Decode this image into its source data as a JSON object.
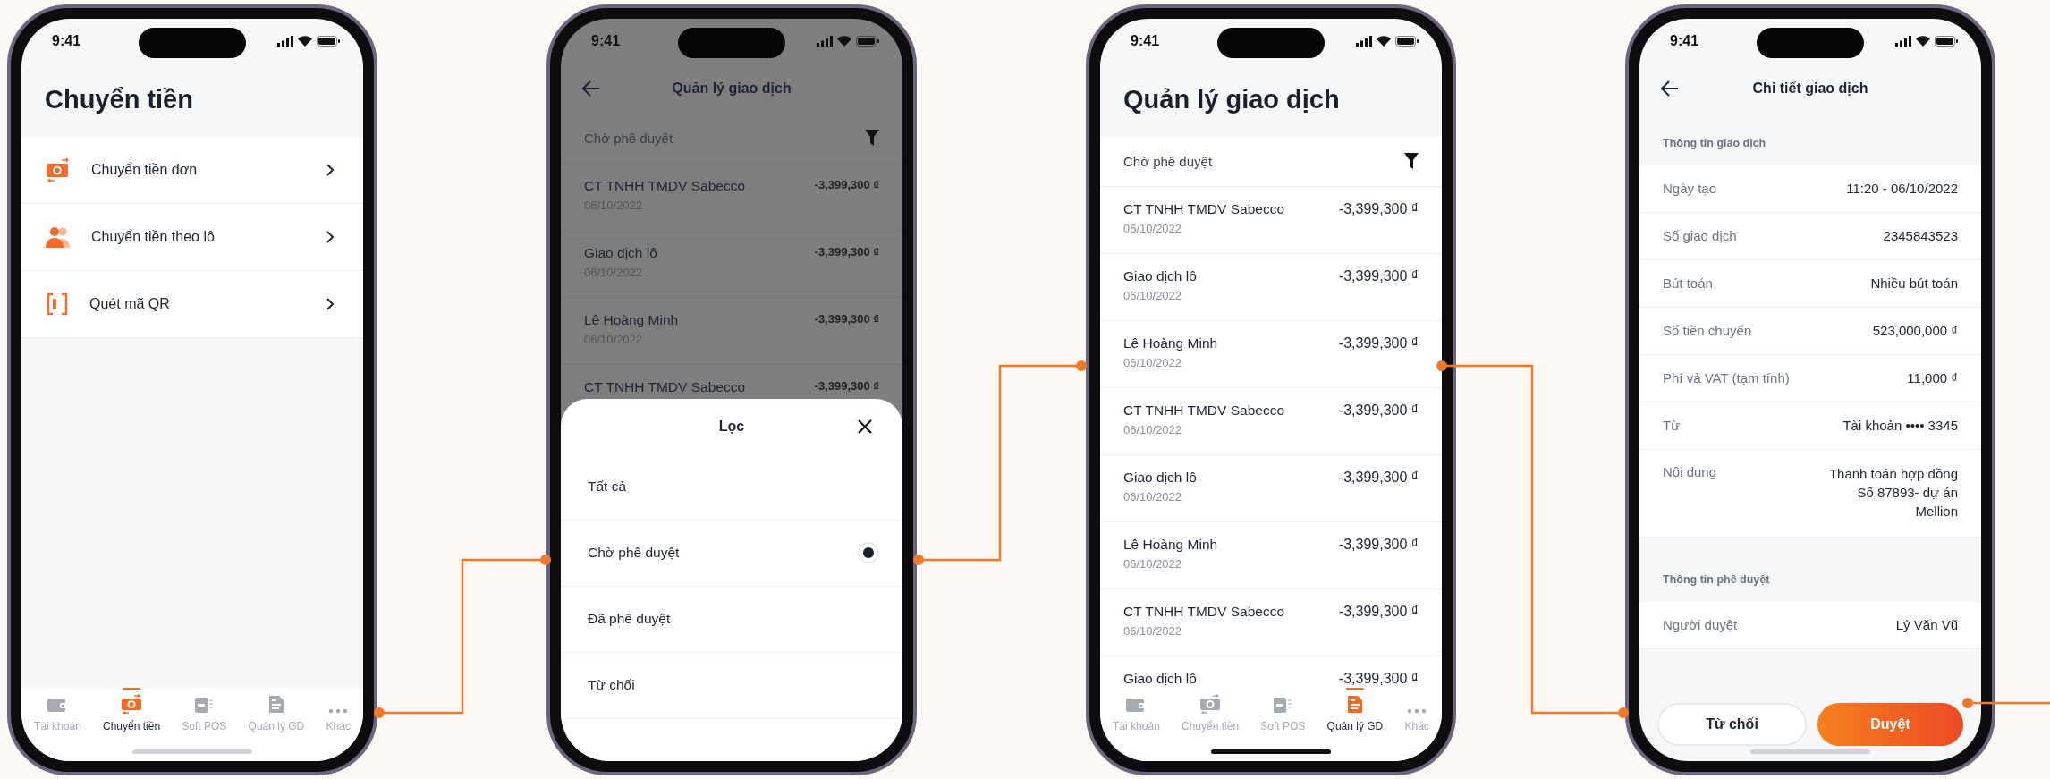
{
  "screens": [
    {
      "kind": "menu",
      "time": "9:41",
      "title": "Chuyển tiền",
      "items": [
        {
          "label": "Chuyển tiền đơn"
        },
        {
          "label": "Chuyển tiền theo lô"
        },
        {
          "label": "Quét mã QR"
        }
      ],
      "nav": [
        {
          "label": "Tài khoản",
          "selected": false
        },
        {
          "label": "Chuyển tiền",
          "selected": true
        },
        {
          "label": "Soft POS",
          "selected": false
        },
        {
          "label": "Quản lý GD",
          "selected": false
        },
        {
          "label": "Khác",
          "selected": false
        }
      ]
    },
    {
      "kind": "filter_sheet",
      "time": "9:41",
      "header_title": "Quản lý giao dịch",
      "filter_label": "Chờ phê duyệt",
      "transactions": [
        {
          "name": "CT TNHH TMDV Sabecco",
          "date": "06/10/2022",
          "amount": "-3,399,300 ₫"
        },
        {
          "name": "Giao dịch lô",
          "date": "06/10/2022",
          "amount": "-3,399,300 ₫"
        },
        {
          "name": "Lê Hoàng Minh",
          "date": "06/10/2022",
          "amount": "-3,399,300 ₫"
        },
        {
          "name": "CT TNHH TMDV Sabecco",
          "amount": "-3,399,300 ₫"
        }
      ],
      "sheet": {
        "title": "Lọc",
        "options": [
          {
            "label": "Tất cả",
            "selected": false
          },
          {
            "label": "Chờ phê duyệt",
            "selected": true
          },
          {
            "label": "Đã phê duyệt",
            "selected": false
          },
          {
            "label": "Từ chối",
            "selected": false
          }
        ]
      }
    },
    {
      "kind": "transaction_list",
      "time": "9:41",
      "title": "Quản lý giao dịch",
      "filter_label": "Chờ phê duyệt",
      "transactions": [
        {
          "name": "CT TNHH TMDV Sabecco",
          "date": "06/10/2022",
          "amount": "-3,399,300 ₫"
        },
        {
          "name": "Giao dịch lô",
          "date": "06/10/2022",
          "amount": "-3,399,300 ₫"
        },
        {
          "name": "Lê Hoàng Minh",
          "date": "06/10/2022",
          "amount": "-3,399,300 ₫"
        },
        {
          "name": "CT TNHH TMDV Sabecco",
          "date": "06/10/2022",
          "amount": "-3,399,300 ₫"
        },
        {
          "name": "Giao dịch lô",
          "date": "06/10/2022",
          "amount": "-3,399,300 ₫"
        },
        {
          "name": "Lê Hoàng Minh",
          "date": "06/10/2022",
          "amount": "-3,399,300 ₫"
        },
        {
          "name": "CT TNHH TMDV Sabecco",
          "date": "06/10/2022",
          "amount": "-3,399,300 ₫"
        },
        {
          "name": "Giao dịch lô",
          "amount": "-3,399,300 ₫"
        }
      ],
      "nav": [
        {
          "label": "Tài khoản",
          "selected": false
        },
        {
          "label": "Chuyển tiền",
          "selected": false
        },
        {
          "label": "Soft POS",
          "selected": false
        },
        {
          "label": "Quản lý GD",
          "selected": true
        },
        {
          "label": "Khác",
          "selected": false
        }
      ]
    },
    {
      "kind": "detail",
      "time": "9:41",
      "header_title": "Chi tiết giao dịch",
      "sections": [
        {
          "title": "Thông tin giao dịch",
          "rows": [
            {
              "label": "Ngày tạo",
              "value": "11:20 - 06/10/2022"
            },
            {
              "label": "Số giao dịch",
              "value": "2345843523"
            },
            {
              "label": "Bút toán",
              "value": "Nhiều bút toán"
            },
            {
              "label": "Số tiền chuyển",
              "value": "523,000,000 ₫"
            },
            {
              "label": "Phí và VAT (tạm tính)",
              "value": "11,000 ₫"
            },
            {
              "label": "Từ",
              "value": "Tài khoản •••• 3345"
            },
            {
              "label": "Nội dung",
              "value": "Thanh toán hợp đồng Số 87893- dự án Mellion"
            }
          ]
        },
        {
          "title": "Thông tin phê duyệt",
          "rows": [
            {
              "label": "Người duyệt",
              "value": "Lý Văn Vũ"
            }
          ]
        }
      ],
      "buttons": [
        {
          "label": "Từ chối",
          "kind": "secondary"
        },
        {
          "label": "Duyệt",
          "kind": "primary"
        }
      ]
    }
  ]
}
